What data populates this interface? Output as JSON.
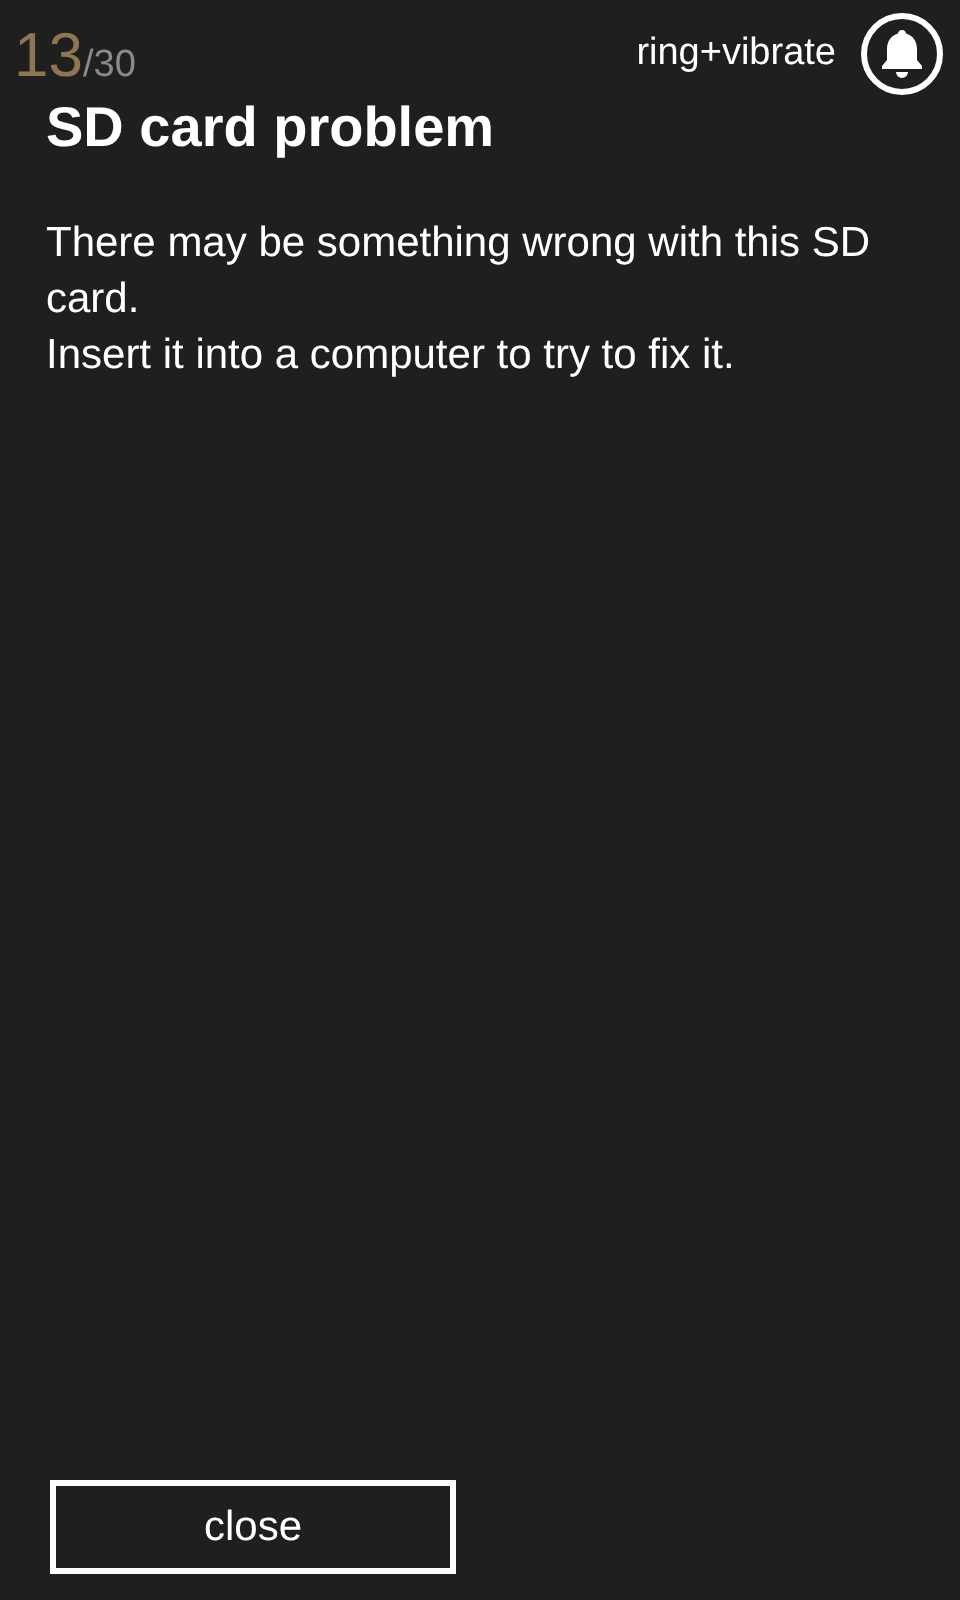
{
  "volume": {
    "level_text": "13",
    "max_text": "/30",
    "mode": "ring+vibrate"
  },
  "dialog": {
    "title": "SD card problem",
    "message": [
      "There may be something wrong with this SD card.",
      "Insert it into a computer to try to fix it."
    ],
    "buttons": [
      "close"
    ]
  }
}
